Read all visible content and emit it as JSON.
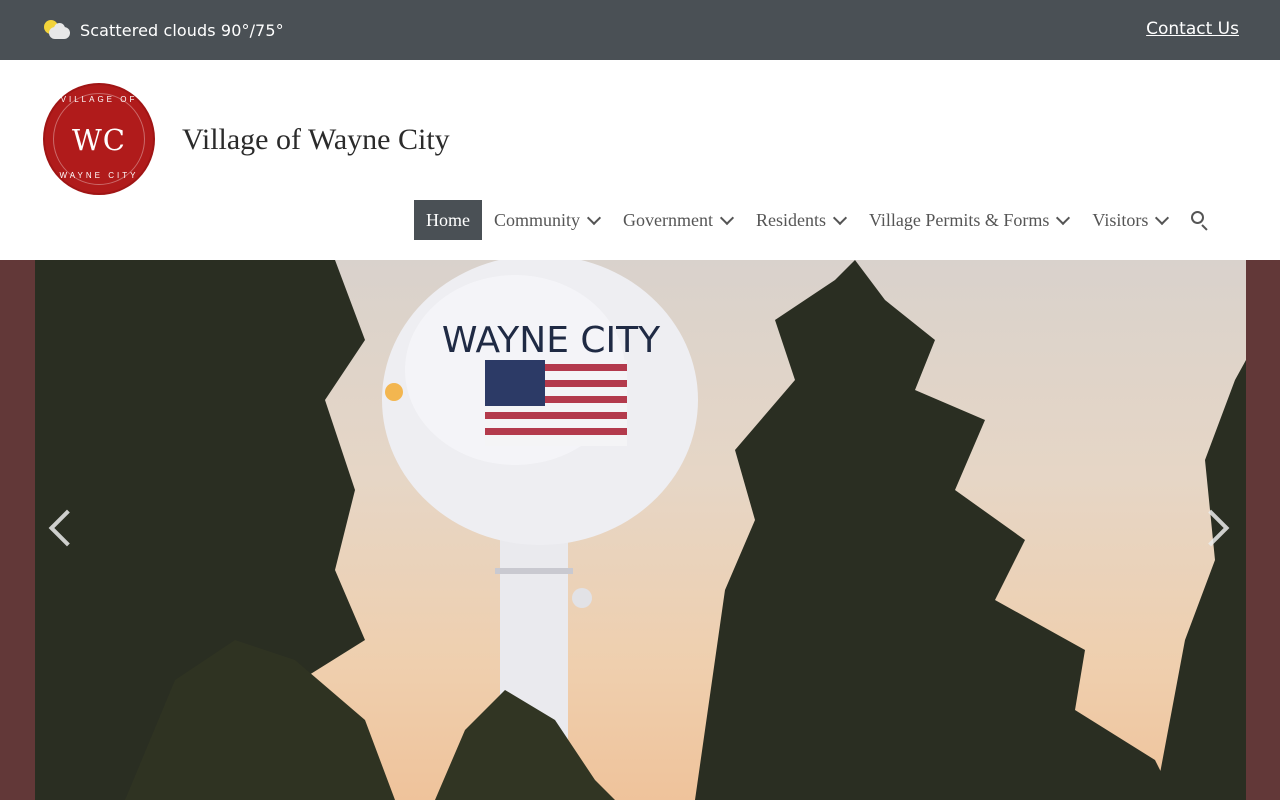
{
  "topbar": {
    "weather_text": "Scattered clouds 90°/75°",
    "weather_icon": "partly-cloudy-icon",
    "contact_label": "Contact Us"
  },
  "header": {
    "logo": {
      "monogram": "WC",
      "ring_top": "VILLAGE OF",
      "ring_bottom": "WAYNE CITY",
      "color": "#b01b1b"
    },
    "site_title": "Village of Wayne City"
  },
  "nav": {
    "items": [
      {
        "label": "Home",
        "active": true,
        "dropdown": false
      },
      {
        "label": "Community",
        "active": false,
        "dropdown": true
      },
      {
        "label": "Government",
        "active": false,
        "dropdown": true
      },
      {
        "label": "Residents",
        "active": false,
        "dropdown": true
      },
      {
        "label": "Village Permits & Forms",
        "active": false,
        "dropdown": true
      },
      {
        "label": "Visitors",
        "active": false,
        "dropdown": true
      }
    ],
    "search_icon": "search-icon"
  },
  "hero": {
    "image_text": "WAYNE CITY",
    "prev_icon": "chevron-left-icon",
    "next_icon": "chevron-right-icon",
    "colors": {
      "frame": "#623838",
      "topbar": "#4a5055"
    }
  }
}
